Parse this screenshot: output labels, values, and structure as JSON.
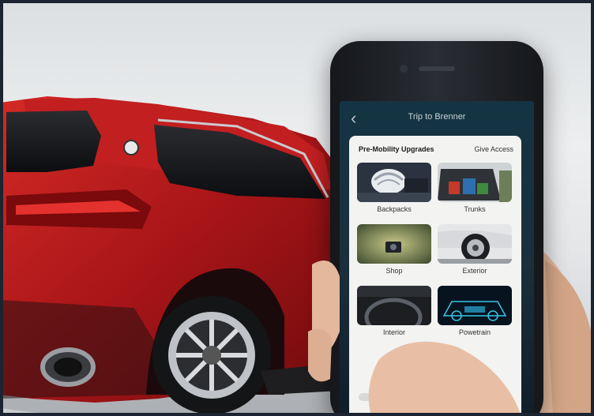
{
  "app": {
    "trip_title": "Trip to Brenner"
  },
  "sheet": {
    "title": "Pre-Mobility Upgrades",
    "give_access": "Give Access",
    "tiles": [
      {
        "label": "Backpacks"
      },
      {
        "label": "Trunks"
      },
      {
        "label": "Shop"
      },
      {
        "label": "Exterior"
      },
      {
        "label": "Interior"
      },
      {
        "label": "Powetrain"
      }
    ]
  },
  "icons": {
    "back": "chevron-left-icon"
  },
  "colors": {
    "car_red": "#b3191c",
    "screen_bg": "#143443",
    "sheet_bg": "#f3f3f1"
  }
}
